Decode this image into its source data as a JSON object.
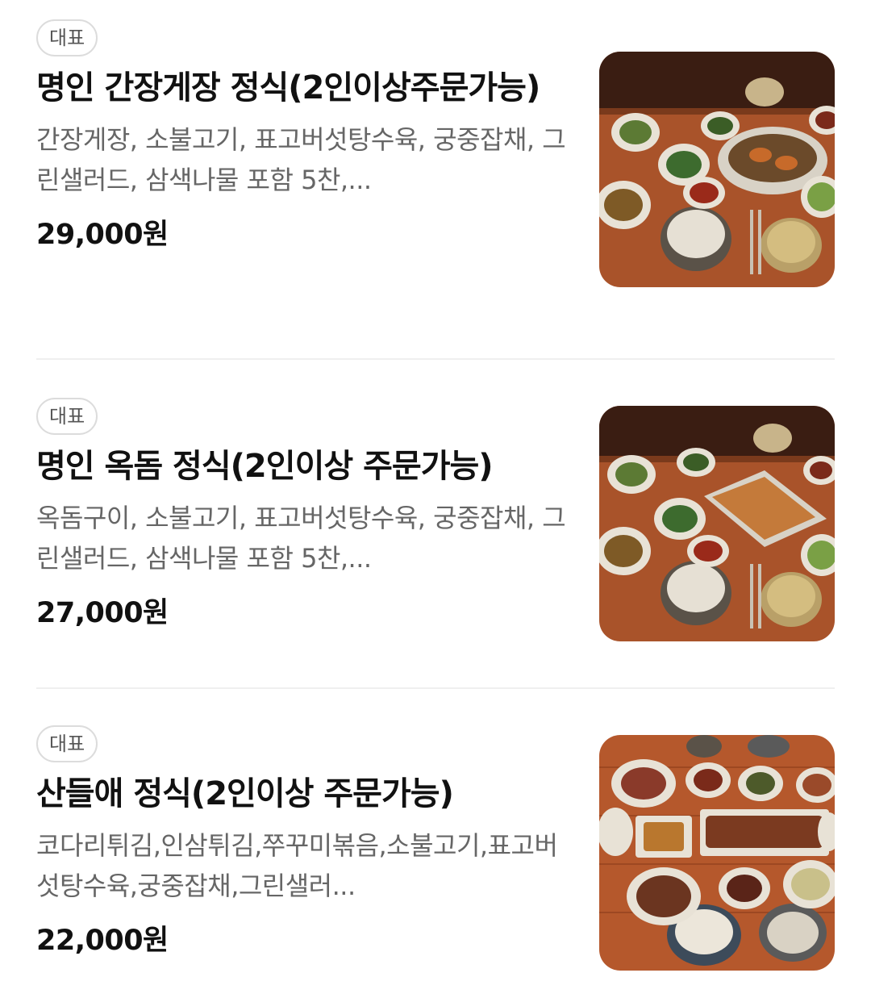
{
  "menu": {
    "items": [
      {
        "badge": "대표",
        "title": "명인 간장게장 정식(2인이상주문가능)",
        "description": "간장게장, 소불고기, 표고버섯탕수육, 궁중잡채, 그린샐러드, 삼색나물 포함 5찬,...",
        "price": "29,000원",
        "image_icon": "food-photo-icon"
      },
      {
        "badge": "대표",
        "title": "명인 옥돔 정식(2인이상 주문가능)",
        "description": "옥돔구이, 소불고기, 표고버섯탕수육, 궁중잡채, 그린샐러드, 삼색나물 포함 5찬,...",
        "price": "27,000원",
        "image_icon": "food-photo-icon"
      },
      {
        "badge": "대표",
        "title": "산들애 정식(2인이상 주문가능)",
        "description": "코다리튀김,인삼튀김,쭈꾸미볶음,소불고기,표고버섯탕수육,궁중잡채,그린샐러...",
        "price": "22,000원",
        "image_icon": "food-photo-icon"
      }
    ]
  },
  "colors": {
    "background": "#ffffff",
    "title": "#111111",
    "description": "#666666",
    "badge_border": "#dcdcdc",
    "divider": "#efefef",
    "table_wood": "#a9532a"
  }
}
